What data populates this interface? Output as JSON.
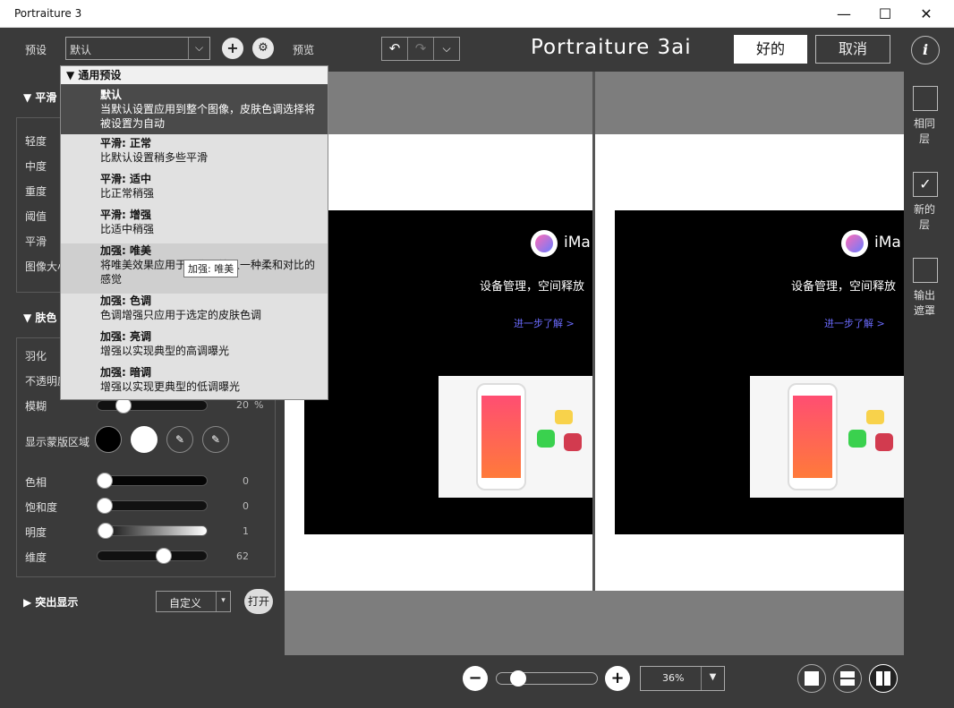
{
  "window": {
    "title": "Portraiture 3",
    "minimize": "—",
    "maximize": "☐",
    "close": "✕"
  },
  "toolbar": {
    "preset_label": "预设",
    "preset_value": "默认",
    "preview_label": "预览",
    "brand": "Portraiture 3ai",
    "ok_label": "好的",
    "cancel_label": "取消",
    "info_label": "i"
  },
  "left_panel": {
    "smoothing_header": "平滑",
    "smoothing_rows": [
      "轻度",
      "中度",
      "重度",
      "阈值",
      "平滑",
      "图像大小"
    ],
    "skin_header": "肤色",
    "skin_rows": [
      {
        "label": "羽化"
      },
      {
        "label": "不透明度"
      },
      {
        "label": "模糊",
        "value": "20",
        "unit": "%",
        "level": 0.2
      }
    ],
    "mask_label": "显示蒙版区域",
    "color_rows": [
      {
        "label": "色相",
        "value": "0",
        "level": 0.0
      },
      {
        "label": "饱和度",
        "value": "0",
        "level": 0.0
      },
      {
        "label": "明度",
        "value": "1",
        "level": 0.01
      },
      {
        "label": "维度",
        "value": "62",
        "level": 0.62
      }
    ],
    "highlight_header": "突出显示",
    "highlight_select": "自定义",
    "highlight_toggle": "打开"
  },
  "dropdown": {
    "header": "通用预设",
    "items": [
      {
        "title": "默认",
        "desc": "当默认设置应用到整个图像，皮肤色调选择将被设置为自动",
        "selected": true
      },
      {
        "title": "平滑: 正常",
        "desc": "比默认设置稍多些平滑"
      },
      {
        "title": "平滑: 适中",
        "desc": "比正常稍强"
      },
      {
        "title": "平滑: 增强",
        "desc": "比适中稍强"
      },
      {
        "title": "加强: 唯美",
        "desc": "将唯美效果应用于图像，给人一种柔和对比的感觉",
        "hover": true
      },
      {
        "title": "加强: 色调",
        "desc": "色调增强只应用于选定的皮肤色调"
      },
      {
        "title": "加强: 亮调",
        "desc": "增强以实现典型的高调曝光"
      },
      {
        "title": "加强: 暗调",
        "desc": "增强以实现更典型的低调曝光"
      }
    ],
    "tooltip": "加强: 唯美"
  },
  "preview": {
    "logo_text": "iMa",
    "headline": "设备管理，空间释放",
    "link": "进一步了解 >"
  },
  "right_sidebar": {
    "same_layer": "相同层",
    "new_layer": "新的层",
    "new_layer_checked": true,
    "output_mask": "输出遮罩"
  },
  "zoom": {
    "value": "36%",
    "level": 0.15
  },
  "colors": {
    "bg": "#3a3a3a",
    "accent_link": "#6b6bff"
  }
}
